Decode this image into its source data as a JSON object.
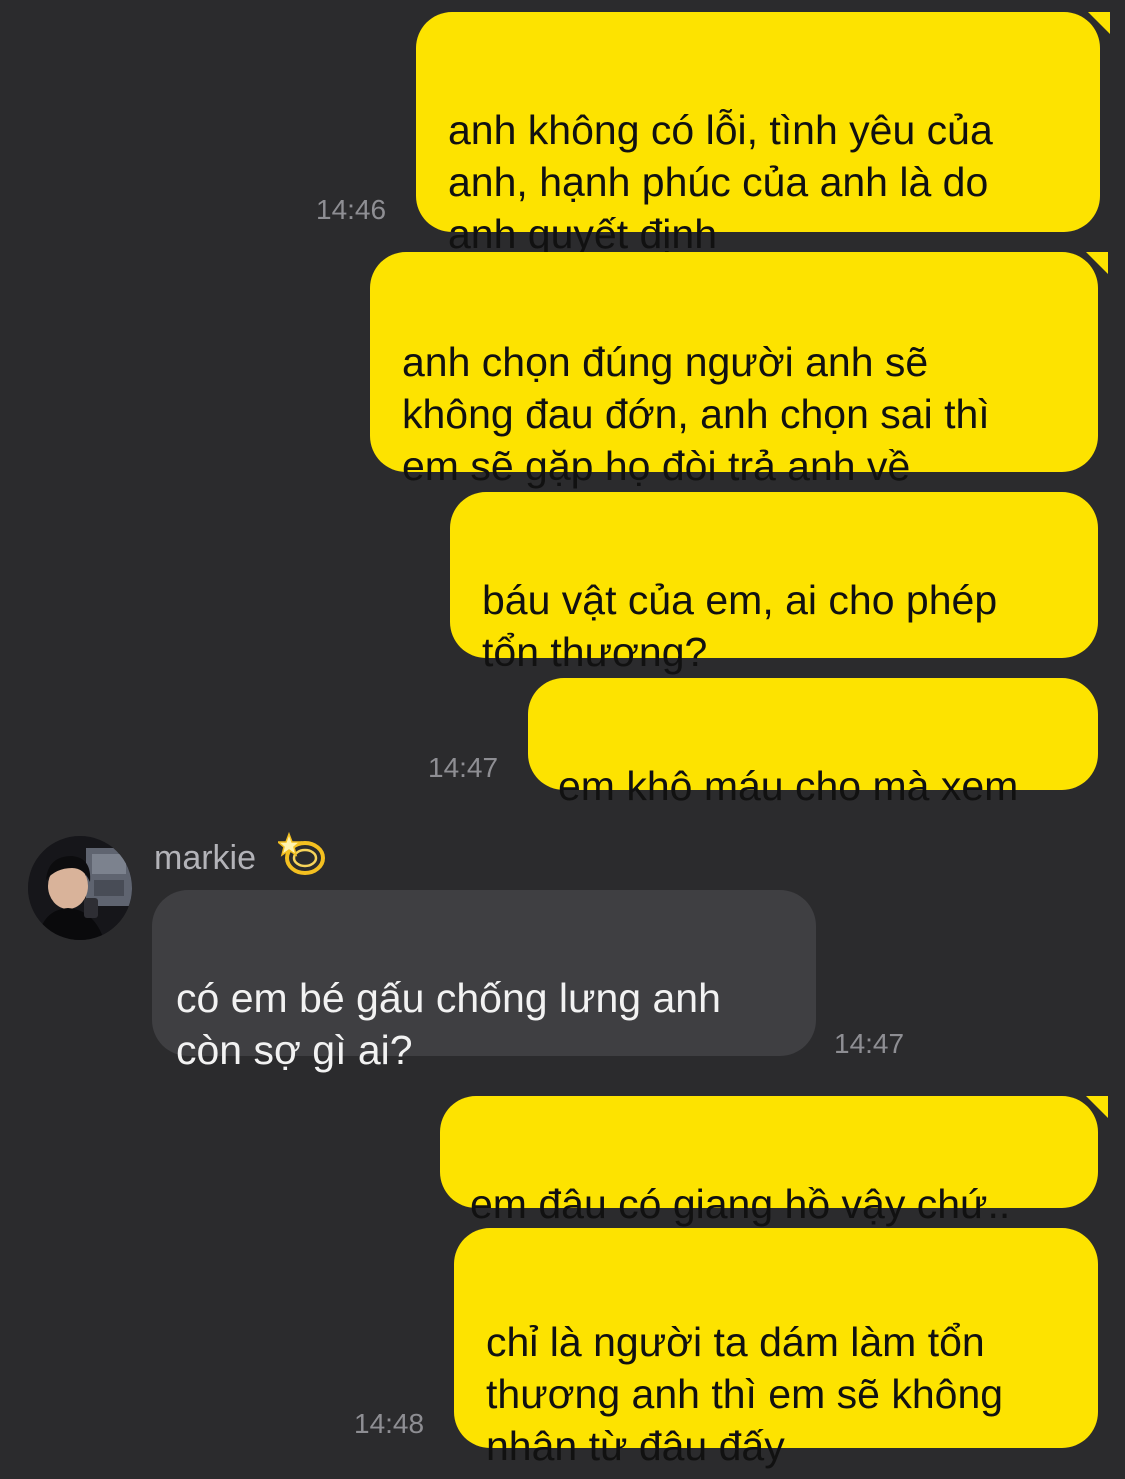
{
  "messages": [
    {
      "text": "anh không có lỗi, tình yêu của\nanh, hạnh phúc của anh là do\nanh quyết định",
      "time": "14:46"
    },
    {
      "text": "anh chọn đúng người anh sẽ\nkhông đau đớn, anh chọn sai thì\nem sẽ gặp họ đòi trả anh về"
    },
    {
      "text": "báu vật của em, ai cho phép\ntổn thương?"
    },
    {
      "text": "em khô máu cho mà xem",
      "time": "14:47"
    },
    {
      "sender": "markie",
      "sender_icon": "dizzy-star-emoji",
      "text": "có em bé gấu chống lưng anh\ncòn sợ gì ai?",
      "time": "14:47"
    },
    {
      "text": "em đâu có giang hồ vậy chứ.."
    },
    {
      "text": "chỉ là người ta dám làm tổn\nthương anh thì em sẽ không\nnhân từ đâu đấy",
      "time": "14:48"
    }
  ],
  "colors": {
    "background": "#2b2b2d",
    "outgoing_bubble": "#fde300",
    "incoming_bubble": "#3f3f42",
    "timestamp": "#8e8e93"
  }
}
